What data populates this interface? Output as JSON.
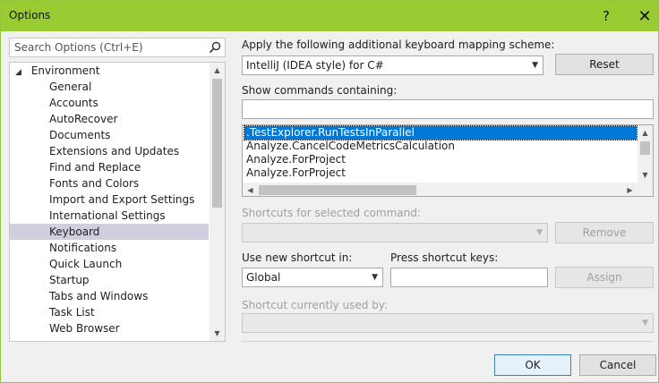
{
  "window": {
    "title": "Options",
    "help_glyph": "?",
    "close_glyph": "✕"
  },
  "search": {
    "placeholder": "Search Options (Ctrl+E)"
  },
  "tree": {
    "root_label": "Environment",
    "items": [
      "General",
      "Accounts",
      "AutoRecover",
      "Documents",
      "Extensions and Updates",
      "Find and Replace",
      "Fonts and Colors",
      "Import and Export Settings",
      "International Settings",
      "Keyboard",
      "Notifications",
      "Quick Launch",
      "Startup",
      "Tabs and Windows",
      "Task List",
      "Web Browser"
    ],
    "selected_index": 9
  },
  "keyboard": {
    "mapping_label": "Apply the following additional keyboard mapping scheme:",
    "mapping_value": "IntelliJ (IDEA style) for C#",
    "reset_label": "Reset",
    "show_commands_label": "Show commands containing:",
    "show_commands_value": "",
    "commands": [
      ".TestExplorer.RunTestsInParallel",
      "Analyze.CancelCodeMetricsCalculation",
      "Analyze.ForProject",
      "Analyze.ForProject"
    ],
    "selected_command_index": 0,
    "shortcuts_label": "Shortcuts for selected command:",
    "remove_label": "Remove",
    "use_new_shortcut_label": "Use new shortcut in:",
    "use_new_shortcut_value": "Global",
    "press_keys_label": "Press shortcut keys:",
    "press_keys_value": "",
    "assign_label": "Assign",
    "currently_used_label": "Shortcut currently used by:"
  },
  "footer": {
    "ok_label": "OK",
    "cancel_label": "Cancel"
  },
  "colors": {
    "titlebar": "#99cc33",
    "selection": "#0078d7",
    "tree_selection": "#cfcfe0"
  }
}
